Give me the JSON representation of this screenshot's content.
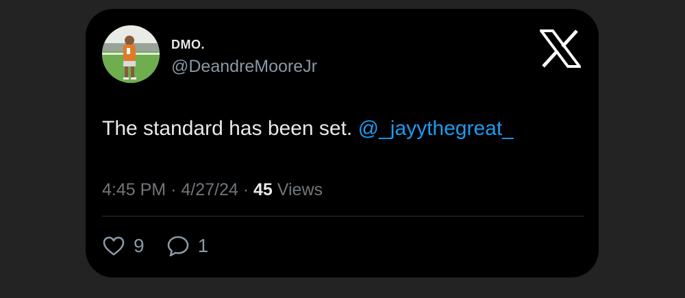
{
  "author": {
    "display_name": "DMO.",
    "handle": "@DeandreMooreJr"
  },
  "tweet": {
    "text": "The standard has been set.",
    "mention": "@_jayythegreat_"
  },
  "meta": {
    "time": "4:45 PM",
    "separator1": "·",
    "date": "4/27/24",
    "separator2": "·",
    "views_count": "45",
    "views_label": "Views"
  },
  "actions": {
    "likes": "9",
    "replies": "1"
  },
  "icons": {
    "logo": "x-logo-icon",
    "like": "heart-icon",
    "reply": "reply-bubble-icon"
  },
  "colors": {
    "background": "#232323",
    "card": "#000000",
    "text": "#e7e9ea",
    "secondary": "#71767b",
    "link": "#1d9bf0"
  }
}
